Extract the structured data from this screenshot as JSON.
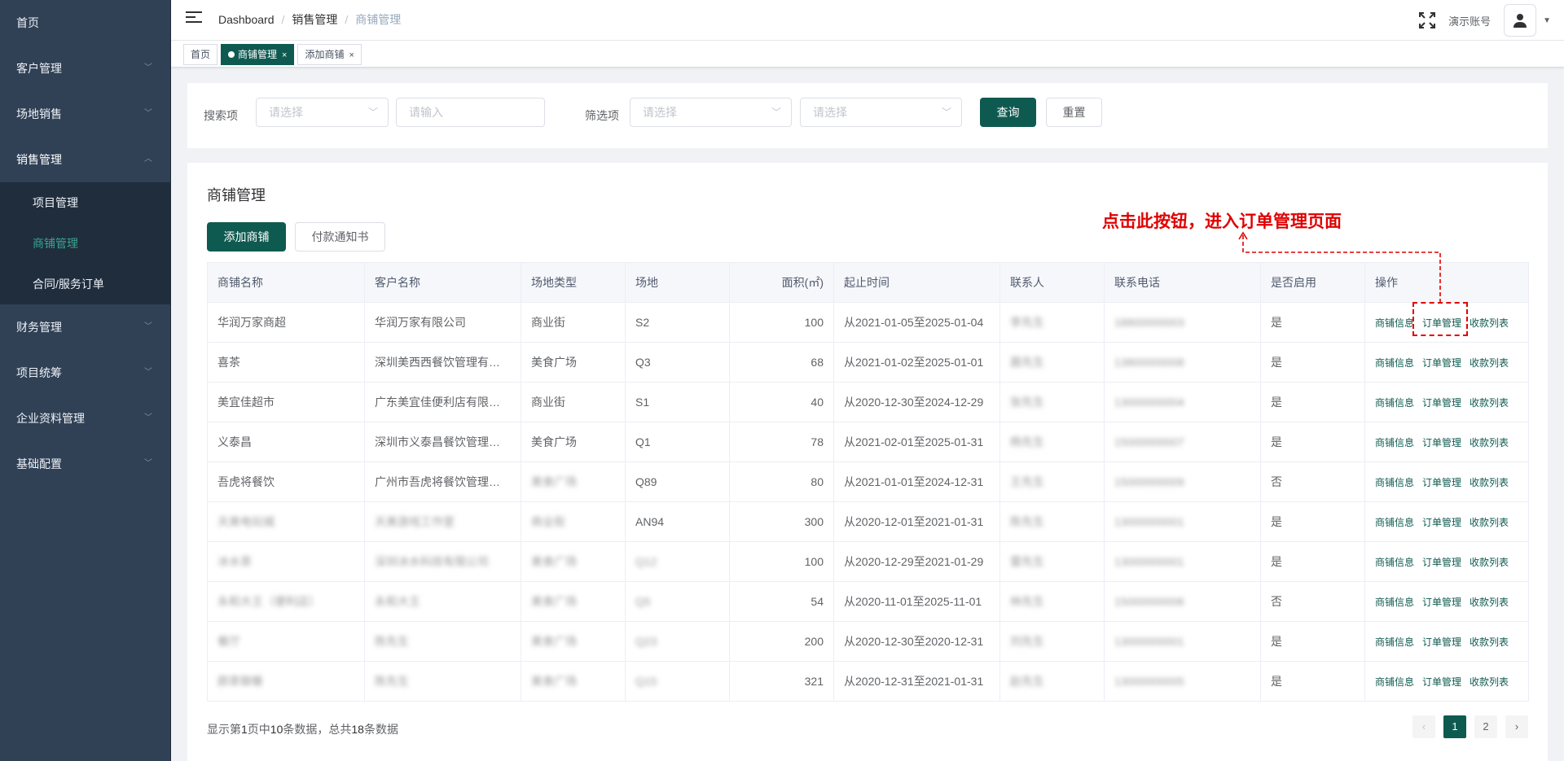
{
  "sidebar": {
    "items": [
      {
        "label": "首页"
      },
      {
        "label": "客户管理"
      },
      {
        "label": "场地销售"
      },
      {
        "label": "销售管理",
        "subitems": [
          {
            "label": "项目管理"
          },
          {
            "label": "商铺管理"
          },
          {
            "label": "合同/服务订单"
          }
        ]
      },
      {
        "label": "财务管理"
      },
      {
        "label": "项目统筹"
      },
      {
        "label": "企业资料管理"
      },
      {
        "label": "基础配置"
      }
    ]
  },
  "navbar": {
    "breadcrumb": [
      "Dashboard",
      "销售管理",
      "商铺管理"
    ],
    "account": "演示账号"
  },
  "tags": [
    {
      "label": "首页"
    },
    {
      "label": "商铺管理"
    },
    {
      "label": "添加商铺"
    }
  ],
  "search": {
    "label1": "搜索项",
    "select1_placeholder": "请选择",
    "input_placeholder": "请输入",
    "label2": "筛选项",
    "select2_placeholder": "请选择",
    "select3_placeholder": "请选择",
    "query": "查询",
    "reset": "重置"
  },
  "panel": {
    "title": "商铺管理",
    "add_button": "添加商铺",
    "notice_button": "付款通知书"
  },
  "table": {
    "headers": [
      "商铺名称",
      "客户名称",
      "场地类型",
      "场地",
      "面积(㎡)",
      "起止时间",
      "联系人",
      "联系电话",
      "是否启用",
      "操作"
    ],
    "actions": [
      "商铺信息",
      "订单管理",
      "收款列表"
    ],
    "rows": [
      {
        "name": "华润万家商超",
        "customer": "华润万家有限公司",
        "type": "商业街",
        "site": "S2",
        "area": "100",
        "period": "从2021-01-05至2025-01-04",
        "contact": "李先生",
        "phone": "18800000003",
        "enabled": "是"
      },
      {
        "name": "喜茶",
        "customer": "深圳美西西餐饮管理有限公司",
        "type": "美食广场",
        "site": "Q3",
        "area": "68",
        "period": "从2021-01-02至2025-01-01",
        "contact": "聂先生",
        "phone": "13800000008",
        "enabled": "是"
      },
      {
        "name": "美宜佳超市",
        "customer": "广东美宜佳便利店有限公司",
        "type": "商业街",
        "site": "S1",
        "area": "40",
        "period": "从2020-12-30至2024-12-29",
        "contact": "张先生",
        "phone": "13000000004",
        "enabled": "是"
      },
      {
        "name": "义泰昌",
        "customer": "深圳市义泰昌餐饮管理有限公司",
        "type": "美食广场",
        "site": "Q1",
        "area": "78",
        "period": "从2021-02-01至2025-01-31",
        "contact": "杨先生",
        "phone": "15000000007",
        "enabled": "是"
      },
      {
        "name": "吾虎将餐饮",
        "customer": "广州市吾虎将餐饮管理有限公司",
        "type": "美食广场",
        "site": "Q89",
        "area": "80",
        "period": "从2021-01-01至2024-12-31",
        "contact": "王先生",
        "phone": "15000000009",
        "enabled": "否"
      },
      {
        "name": "天美电玩城",
        "customer": "天美游戏工作室",
        "type": "商业街",
        "site": "AN94",
        "area": "300",
        "period": "从2020-12-01至2021-01-31",
        "contact": "陈先生",
        "phone": "13000000001",
        "enabled": "是"
      },
      {
        "name": "冰水茶",
        "customer": "深圳冰水科技有限公司",
        "type": "美食广场",
        "site": "Q12",
        "area": "100",
        "period": "从2020-12-29至2021-01-29",
        "contact": "雷先生",
        "phone": "13000000001",
        "enabled": "是"
      },
      {
        "name": "永和大王（便利店）",
        "customer": "永和大王",
        "type": "美食广场",
        "site": "Q5",
        "area": "54",
        "period": "从2020-11-01至2025-11-01",
        "contact": "林先生",
        "phone": "15000000006",
        "enabled": "否"
      },
      {
        "name": "餐厅",
        "customer": "陈先生",
        "type": "美食广场",
        "site": "Q23",
        "area": "200",
        "period": "从2020-12-30至2020-12-31",
        "contact": "刘先生",
        "phone": "13000000001",
        "enabled": "是"
      },
      {
        "name": "颜茶御餐",
        "customer": "陈先生",
        "type": "美食广场",
        "site": "Q15",
        "area": "321",
        "period": "从2020-12-31至2021-01-31",
        "contact": "赵先生",
        "phone": "13000000005",
        "enabled": "是"
      }
    ]
  },
  "footer": {
    "prefix": "显示第",
    "page": "1",
    "mid1": "页中",
    "count": "10",
    "mid2": "条数据，总共",
    "total": "18",
    "suffix": "条数据"
  },
  "pager": {
    "prev": "‹",
    "pages": [
      "1",
      "2"
    ],
    "next": "›"
  },
  "annotation": "点击此按钮，进入订单管理页面",
  "colors": {
    "sidebar": "#304156",
    "primary": "#0f5a50",
    "annotation": "#e00000"
  }
}
